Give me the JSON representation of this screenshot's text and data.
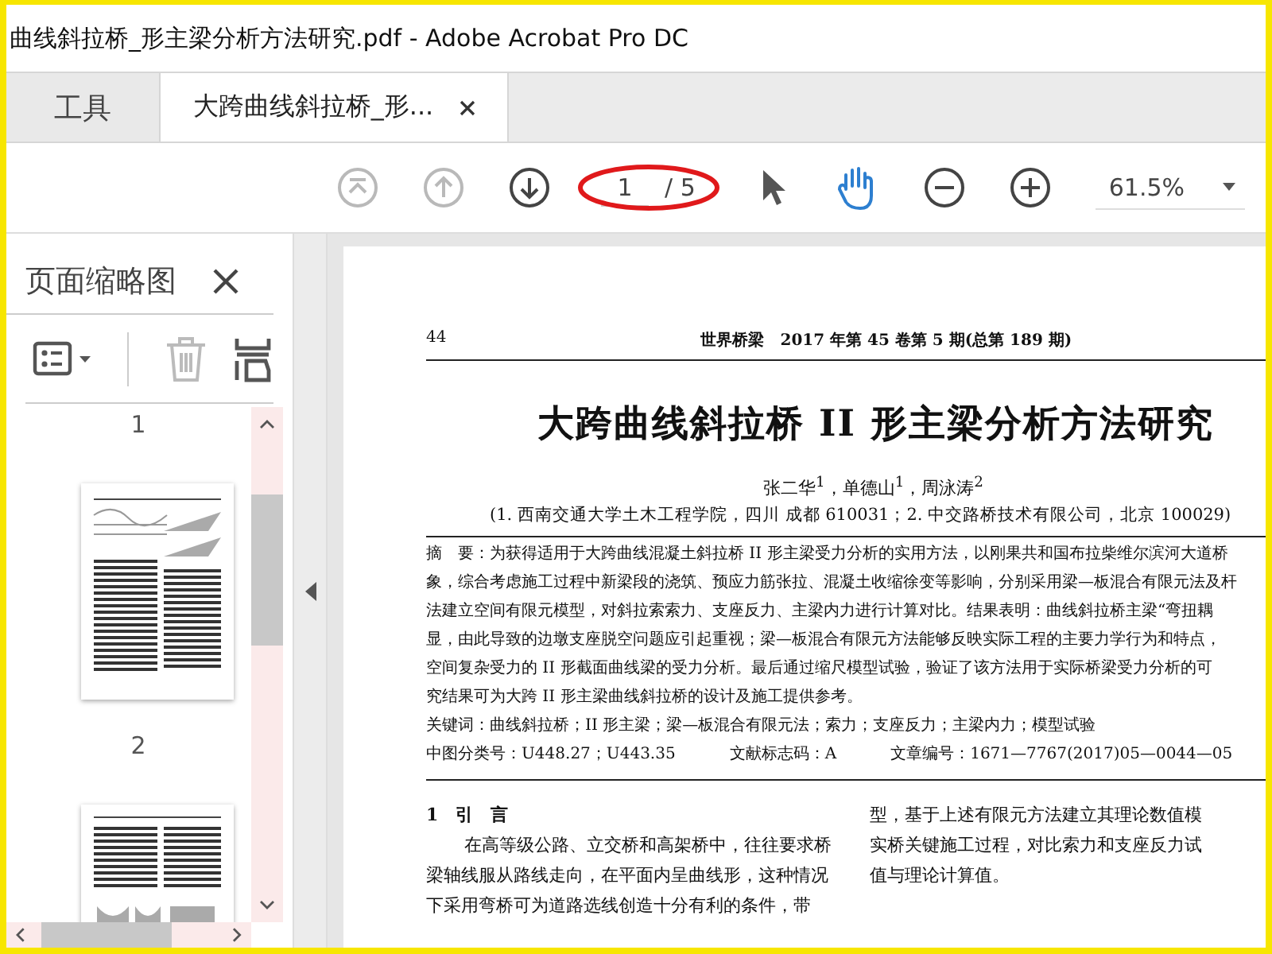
{
  "window": {
    "title": "曲线斜拉桥_形主梁分析方法研究.pdf - Adobe Acrobat Pro DC"
  },
  "tabs": [
    {
      "label": "工具",
      "selected": false,
      "closable": false
    },
    {
      "label": "大跨曲线斜拉桥_形...",
      "selected": true,
      "closable": true
    }
  ],
  "toolbar": {
    "nav": [
      {
        "kind": "first",
        "disabled": true
      },
      {
        "kind": "prev",
        "disabled": true
      },
      {
        "kind": "next",
        "disabled": false
      }
    ],
    "page": {
      "value": "1",
      "total": "/ 5"
    },
    "tools": [
      {
        "kind": "select",
        "selected": false
      },
      {
        "kind": "hand",
        "selected": true
      },
      {
        "kind": "zoom-out",
        "selected": false
      },
      {
        "kind": "zoom-in",
        "selected": false
      }
    ],
    "zoom": {
      "value": "61.5%"
    }
  },
  "sidebar": {
    "title": "页面缩略图",
    "actions": [
      {
        "kind": "options",
        "disabled": false
      },
      {
        "kind": "delete",
        "disabled": true
      },
      {
        "kind": "extract",
        "disabled": false
      }
    ],
    "thumbnails": [
      {
        "label": "1",
        "selected": false
      },
      {
        "label": "2",
        "selected": false
      }
    ]
  },
  "document": {
    "page_number": "44",
    "running_head": "世界桥梁　2017 年第 45 卷第 5 期(总第 189 期)",
    "title": "大跨曲线斜拉桥 II 形主梁分析方法研究",
    "authors": "张二华$^{1}$，单德山$^{1}$，周泳涛$^{2}$",
    "affiliation": "(1. 西南交通大学土木工程学院，四川 成都 610031；2. 中交路桥技术有限公司，北京 100029)",
    "abstract_lines": [
      "摘　要：为获得适用于大跨曲线混凝土斜拉桥 II 形主梁受力分析的实用方法，以刚果共和国布拉柴维尔滨河大道桥",
      "象，综合考虑施工过程中新梁段的浇筑、预应力筋张拉、混凝土收缩徐变等影响，分别采用梁—板混合有限元法及杆",
      "法建立空间有限元模型，对斜拉索索力、支座反力、主梁内力进行计算对比。结果表明：曲线斜拉桥主梁“弯扭耦",
      "显，由此导致的边墩支座脱空问题应引起重视；梁—板混合有限元方法能够反映实际工程的主要力学行为和特点，",
      "空间复杂受力的 II 形截面曲线梁的受力分析。最后通过缩尺模型试验，验证了该方法用于实际桥梁受力分析的可",
      "究结果可为大跨 II 形主梁曲线斜拉桥的设计及施工提供参考。"
    ],
    "keywords": "关键词：曲线斜拉桥；II 形主梁；梁—板混合有限元法；索力；支座反力；主梁内力；模型试验",
    "meta": [
      "中图分类号：U448.27；U443.35",
      "文献标志码：A",
      "文章编号：1671—7767(2017)05—0044—05"
    ],
    "section_heading": "1　引　言",
    "left_column": [
      "在高等级公路、立交桥和高架桥中，往往要求桥",
      "梁轴线服从路线走向，在平面内呈曲线形，这种情况",
      "下采用弯桥可为道路选线创造十分有利的条件，带"
    ],
    "right_column": [
      "型，基于上述有限元方法建立其理论数值模",
      "实桥关键施工过程，对比索力和支座反力试",
      "值与理论计算值。"
    ]
  }
}
